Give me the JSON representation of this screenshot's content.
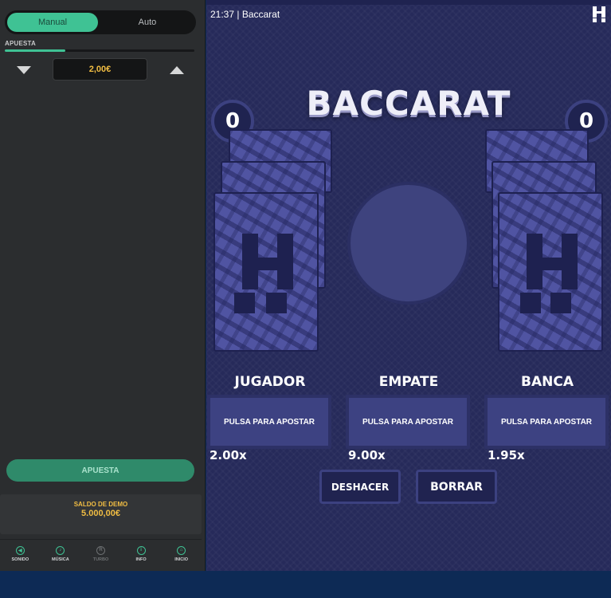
{
  "left_panel": {
    "mode_toggle": {
      "manual_label": "Manual",
      "auto_label": "Auto",
      "selected": "Manual"
    },
    "bet_label": "APUESTA",
    "bet_slider_fraction": 0.32,
    "bet_amount": "2,00€",
    "bet_button_label": "APUESTA",
    "balance": {
      "label": "SALDO DE DEMO",
      "value": "5.000,00€"
    },
    "bottom_bar": [
      {
        "label": "SONIDO",
        "icon": "speaker-icon",
        "glyph": "◀"
      },
      {
        "label": "MÚSICA",
        "icon": "music-note-icon",
        "glyph": "♪"
      },
      {
        "label": "TURBO",
        "icon": "turbo-icon",
        "glyph": "R"
      },
      {
        "label": "INFO",
        "icon": "info-icon",
        "glyph": "i"
      },
      {
        "label": "INICIO",
        "icon": "home-icon",
        "glyph": "⌂"
      }
    ]
  },
  "game": {
    "time": "21:37",
    "name": "Baccarat",
    "title": "BACCARAT",
    "player_score": "0",
    "banker_score": "0",
    "player": {
      "label": "JUGADOR",
      "button": "PULSA PARA APOSTAR",
      "odds": "2.00x"
    },
    "tie": {
      "label": "EMPATE",
      "button": "PULSA PARA APOSTAR",
      "odds": "9.00x"
    },
    "banker": {
      "label": "BANCA",
      "button": "PULSA PARA APOSTAR",
      "odds": "1.95x"
    },
    "undo_label": "DESHACER",
    "clear_label": "BORRAR",
    "colors": {
      "accent_green": "#3fc294",
      "gold": "#f1bd43",
      "table_bg": "#262a5a",
      "card_blue": "#5054a2"
    }
  }
}
